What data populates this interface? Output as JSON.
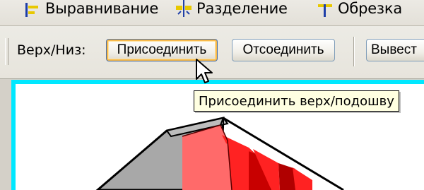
{
  "toolbar_top": {
    "items": [
      {
        "label": "Выравнивание",
        "icon": "align-icon"
      },
      {
        "label": "Разделение",
        "icon": "split-icon"
      },
      {
        "label": "Обрезка",
        "icon": "trim-icon"
      }
    ]
  },
  "toolbar_row2": {
    "label": "Верх/Низ:",
    "buttons": [
      {
        "label": "Присоединить"
      },
      {
        "label": "Отсоединить"
      },
      {
        "label": "Вывест"
      }
    ]
  },
  "tooltip": {
    "text": "Присоединить верх/подошву"
  },
  "colors": {
    "viewport_border": "#00e8ff",
    "red_face": "#ff2222",
    "red_light": "#ff6a6a",
    "red_dark": "#b00000",
    "gray_face": "#a8a8a8",
    "tooltip_bg": "#ffffe1"
  }
}
